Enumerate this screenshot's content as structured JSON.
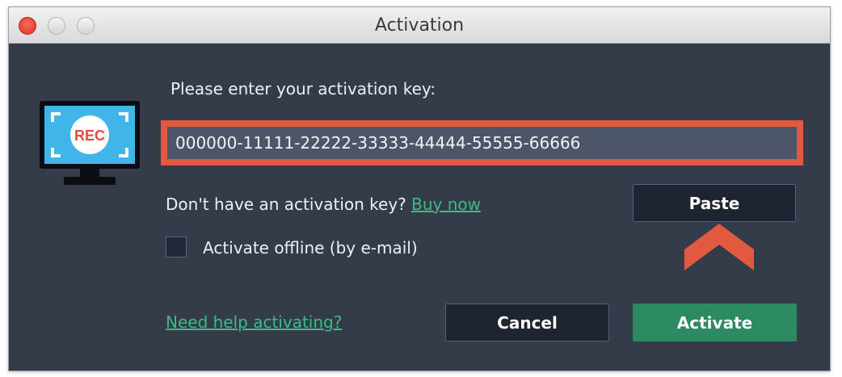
{
  "window": {
    "title": "Activation"
  },
  "app_icon": {
    "name": "rec-monitor-icon",
    "label": "REC"
  },
  "form": {
    "prompt": "Please enter your activation key:",
    "key_value": "000000-11111-22222-33333-44444-55555-66666",
    "no_key_text": "Don't have an activation key?",
    "buy_now_label": "Buy now",
    "paste_label": "Paste",
    "offline_label": "Activate offline (by e-mail)",
    "offline_checked": false
  },
  "footer": {
    "help_link": "Need help activating?",
    "cancel_label": "Cancel",
    "activate_label": "Activate"
  },
  "colors": {
    "accent_highlight": "#e3593f",
    "link": "#3dbb86",
    "activate_button": "#2b8a62",
    "panel_bg": "#343b49"
  }
}
